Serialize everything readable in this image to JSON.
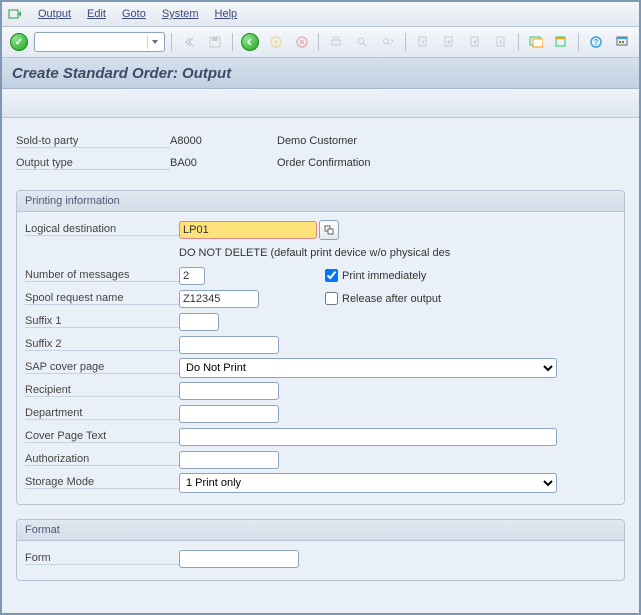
{
  "menu": {
    "output": "Output",
    "edit": "Edit",
    "goto": "Goto",
    "system": "System",
    "help": "Help"
  },
  "title": "Create Standard Order: Output",
  "header": {
    "soldto_lbl": "Sold-to party",
    "soldto_val": "A8000",
    "soldto_name": "Demo Customer",
    "outtype_lbl": "Output type",
    "outtype_val": "BA00",
    "outtype_name": "Order Confirmation"
  },
  "print": {
    "group_title": "Printing information",
    "dest_lbl": "Logical destination",
    "dest": "LP01",
    "dest_note": "DO NOT DELETE (default print device w/o physical des",
    "num_lbl": "Number of messages",
    "num": "2",
    "print_now_lbl": "Print immediately",
    "print_now": true,
    "spool_lbl": "Spool request name",
    "spool": "Z12345",
    "release_lbl": "Release after output",
    "release": false,
    "suf1_lbl": "Suffix 1",
    "suf1": "",
    "suf2_lbl": "Suffix 2",
    "suf2": "",
    "cover_lbl": "SAP cover page",
    "cover": "Do Not Print",
    "recip_lbl": "Recipient",
    "recip": "",
    "dept_lbl": "Department",
    "dept": "",
    "covertxt_lbl": "Cover Page Text",
    "covertxt": "",
    "auth_lbl": "Authorization",
    "auth": "",
    "store_lbl": "Storage Mode",
    "store": "1 Print only"
  },
  "format": {
    "group_title": "Format",
    "form_lbl": "Form",
    "form": ""
  }
}
